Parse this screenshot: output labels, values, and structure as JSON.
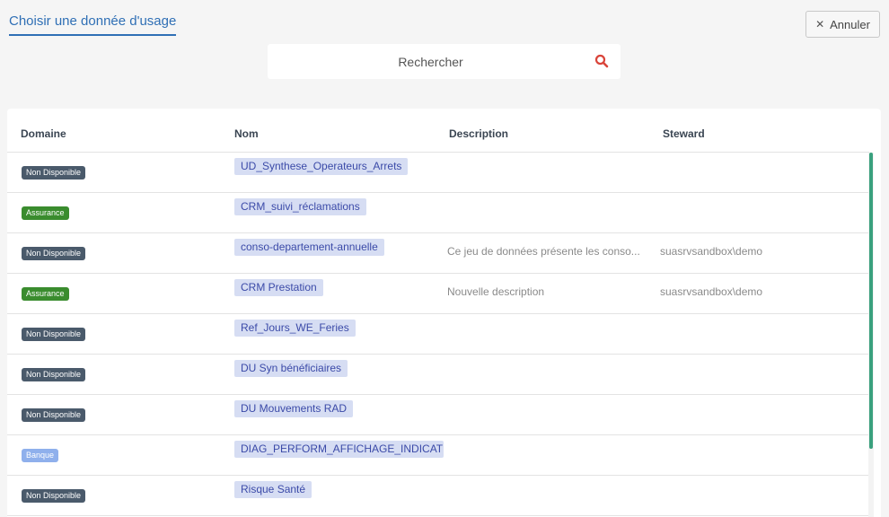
{
  "header": {
    "title": "Choisir une donnée d'usage",
    "cancel_label": "Annuler"
  },
  "search": {
    "placeholder": "Rechercher"
  },
  "table": {
    "columns": [
      "Domaine",
      "Nom",
      "Description",
      "Steward"
    ],
    "rows": [
      {
        "domain": "Non Disponible",
        "domain_color": "#4a5a6b",
        "name": "UD_Synthese_Operateurs_Arrets",
        "description": "",
        "steward": ""
      },
      {
        "domain": "Assurance",
        "domain_color": "#3a8c2e",
        "name": "CRM_suivi_réclamations",
        "description": "",
        "steward": ""
      },
      {
        "domain": "Non Disponible",
        "domain_color": "#4a5a6b",
        "name": "conso-departement-annuelle",
        "description": "Ce jeu de données présente les conso...",
        "steward": "suasrvsandbox\\demo"
      },
      {
        "domain": "Assurance",
        "domain_color": "#3a8c2e",
        "name": "CRM Prestation",
        "description": "Nouvelle description",
        "steward": "suasrvsandbox\\demo"
      },
      {
        "domain": "Non Disponible",
        "domain_color": "#4a5a6b",
        "name": "Ref_Jours_WE_Feries",
        "description": "",
        "steward": ""
      },
      {
        "domain": "Non Disponible",
        "domain_color": "#4a5a6b",
        "name": "DU Syn bénéficiaires",
        "description": "",
        "steward": ""
      },
      {
        "domain": "Non Disponible",
        "domain_color": "#4a5a6b",
        "name": "DU Mouvements RAD",
        "description": "",
        "steward": ""
      },
      {
        "domain": "Banque",
        "domain_color": "#8fb0ec",
        "name": "DIAG_PERFORM_AFFICHAGE_INDICATEURS",
        "description": "",
        "steward": ""
      },
      {
        "domain": "Non Disponible",
        "domain_color": "#4a5a6b",
        "name": "Risque Santé",
        "description": "",
        "steward": ""
      }
    ]
  },
  "colors": {
    "accent": "#2f6fb5",
    "scrollbar": "#3aa07e",
    "search_icon": "#d9443a"
  }
}
